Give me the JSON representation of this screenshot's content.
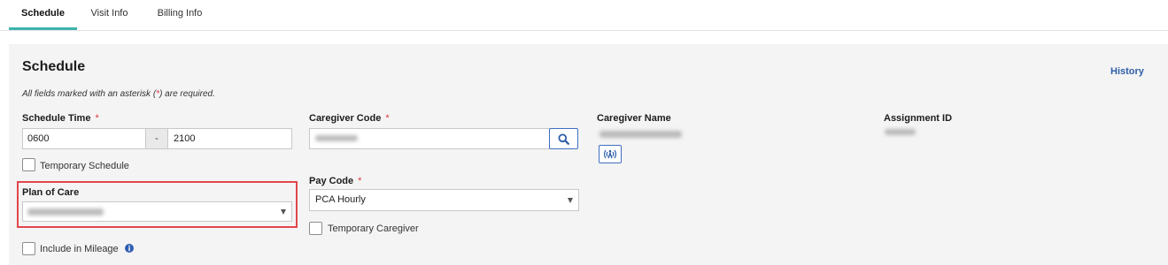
{
  "tabs": [
    {
      "label": "Schedule",
      "active": true
    },
    {
      "label": "Visit Info",
      "active": false
    },
    {
      "label": "Billing Info",
      "active": false
    }
  ],
  "colors": {
    "accent": "#3bb3ab",
    "required": "#d9363e",
    "link": "#2e5ea8",
    "highlight_border": "#e2474c",
    "button_border": "#3f6fc1",
    "panel_background": "#f4f4f4"
  },
  "icons": {
    "search": "search-icon",
    "caregiver_lookup": "broadcast-user-icon",
    "info": "info-icon",
    "dropdown": "chevron-down-icon"
  },
  "panel": {
    "title": "Schedule",
    "history_link": "History",
    "required_note_prefix": "All fields marked with an asterisk (",
    "required_note_star": "*",
    "required_note_suffix": ") are required."
  },
  "schedule_time": {
    "label": "Schedule Time",
    "required_mark": "*",
    "start": "0600",
    "separator": "-",
    "end": "2100"
  },
  "temporary_schedule": {
    "label": "Temporary Schedule",
    "checked": false
  },
  "plan_of_care": {
    "label": "Plan of Care"
  },
  "include_in_mileage": {
    "label": "Include in Mileage",
    "checked": false
  },
  "caregiver_code": {
    "label": "Caregiver Code",
    "required_mark": "*"
  },
  "pay_code": {
    "label": "Pay Code",
    "required_mark": "*",
    "selected": "PCA Hourly"
  },
  "temporary_caregiver": {
    "label": "Temporary Caregiver",
    "checked": false
  },
  "caregiver_name": {
    "label": "Caregiver Name"
  },
  "assignment_id": {
    "label": "Assignment ID"
  }
}
